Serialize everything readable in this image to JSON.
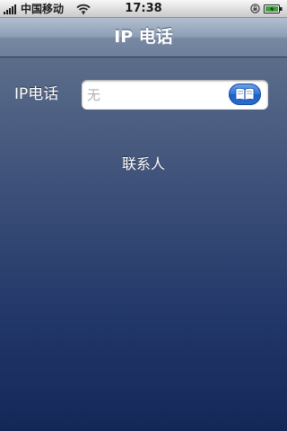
{
  "status_bar": {
    "carrier": "中国移动",
    "time": "17:38"
  },
  "nav_bar": {
    "title": "IP 电话"
  },
  "form": {
    "ip_label": "IP电话",
    "ip_input_placeholder": "无",
    "ip_input_value": ""
  },
  "contacts": {
    "label": "联系人"
  },
  "icons": {
    "signal": "signal-bars-icon",
    "wifi": "wifi-icon",
    "lock": "rotation-lock-icon",
    "battery": "battery-icon",
    "address_book": "address-book-icon"
  },
  "colors": {
    "nav_bar": "#8b9cb4",
    "content_background": "#223769",
    "accent_button": "#2f74d8"
  }
}
